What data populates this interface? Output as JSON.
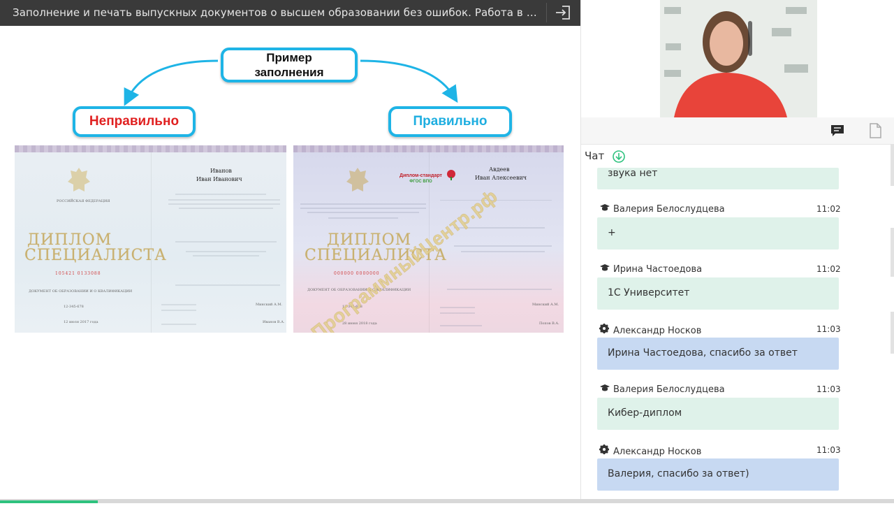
{
  "titlebar": {
    "title": "Заполнение и печать выпускных документов о высшем образовании без ошибок. Работа в п..."
  },
  "slide": {
    "example_label": "Пример заполнения",
    "wrong_label": "Неправильно",
    "right_label": "Правильно",
    "accent_color": "#1eb4e6",
    "wrong_color": "#e02020",
    "diploma_wrong": {
      "heading_line1": "ДИПЛОМ",
      "heading_line2": "СПЕЦИАЛИСТА",
      "country": "РОССИЙСКАЯ ФЕДЕРАЦИЯ",
      "surname": "Иванов",
      "given_names": "Иван Иванович",
      "serial": "105421 0133088",
      "doc_title": "ДОКУМЕНТ ОБ ОБРАЗОВАНИИ И О КВАЛИФИКАЦИИ",
      "reg_number": "12-345-678",
      "issue_date": "12 июля 2017 года",
      "signer1": "Минский А.М.",
      "signer2": "Иванов В.А."
    },
    "diploma_right": {
      "heading_line1": "ДИПЛОМ",
      "heading_line2": "СПЕЦИАЛИСТА",
      "standard_line1": "Диплом-стандарт",
      "standard_line2": "ФГОС ВПО",
      "surname": "Авдеев",
      "given_names": "Иван Алексеевич",
      "serial": "000000 0000000",
      "doc_title": "ДОКУМЕНТ ОБ ОБРАЗОВАНИИ И О КВАЛИФИКАЦИИ",
      "reg_number": "12-345-678",
      "issue_date": "28 июня 2018 года",
      "signer1": "Минский А.М.",
      "signer2": "Попов В.А.",
      "watermark": "ПрограммныйЦентр.рф"
    }
  },
  "chat": {
    "heading": "Чат",
    "messages": [
      {
        "author": "",
        "time": "",
        "text": "звука нет",
        "style": "green",
        "icon": ""
      },
      {
        "author": "Валерия Белослудцева",
        "time": "11:02",
        "text": "+",
        "style": "green",
        "icon": "graduation-cap-icon"
      },
      {
        "author": "Ирина Частоедова",
        "time": "11:02",
        "text": "1С Университет",
        "style": "green",
        "icon": "graduation-cap-icon"
      },
      {
        "author": "Александр Носков",
        "time": "11:03",
        "text": "Ирина Частоедова, спасибо за ответ",
        "style": "blue",
        "icon": "gear-icon"
      },
      {
        "author": "Валерия Белослудцева",
        "time": "11:03",
        "text": "Кибер-диплом",
        "style": "green",
        "icon": "graduation-cap-icon"
      },
      {
        "author": "Александр Носков",
        "time": "11:03",
        "text": "Валерия, спасибо за ответ)",
        "style": "blue",
        "icon": "gear-icon"
      }
    ]
  },
  "colors": {
    "green_bubble": "#dff2ea",
    "blue_bubble": "#c7d9f2",
    "titlebar_bg": "#3a3a3a",
    "progress": "#2ec27e"
  }
}
